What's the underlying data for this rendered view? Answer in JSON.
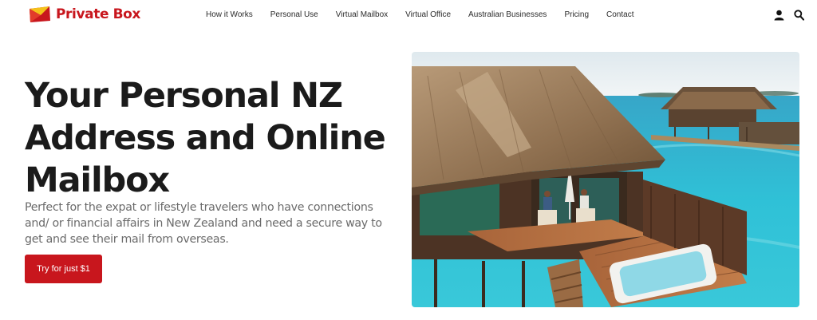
{
  "brand": {
    "name": "Private Box",
    "primary_color": "#c8161d",
    "highlight_color": "#f5d23a"
  },
  "nav": {
    "items": [
      {
        "label": "How it Works",
        "active": false
      },
      {
        "label": "Personal Use",
        "active": true
      },
      {
        "label": "Virtual Mailbox",
        "active": false
      },
      {
        "label": "Virtual Office",
        "active": false
      },
      {
        "label": "Australian Businesses",
        "active": false
      },
      {
        "label": "Pricing",
        "active": false
      },
      {
        "label": "Contact",
        "active": false
      }
    ],
    "icons": [
      "user-icon",
      "search-icon"
    ]
  },
  "hero": {
    "title_lines": [
      "Your Personal NZ",
      "Address and Online",
      "Mailbox"
    ],
    "description": "Perfect for the expat or lifestyle travelers who have connections and/ or financial affairs in New Zealand and need a secure way to get and see their mail from overseas.",
    "cta_label": "Try for just $1",
    "image_subject": "overwater-villa-photo"
  }
}
